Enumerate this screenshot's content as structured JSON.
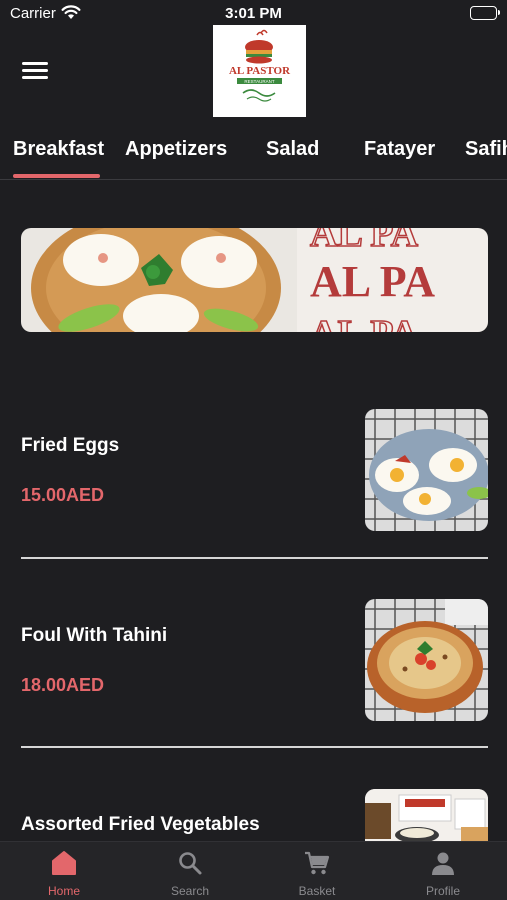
{
  "status_bar": {
    "carrier": "Carrier",
    "time": "3:01 PM"
  },
  "header": {
    "logo_text": "AL PASTOR",
    "logo_subtext": "RESTAURANT"
  },
  "tabs": [
    {
      "label": "Breakfast",
      "active": true
    },
    {
      "label": "Appetizers",
      "active": false
    },
    {
      "label": "Salad",
      "active": false
    },
    {
      "label": "Fatayer",
      "active": false
    },
    {
      "label": "Safih",
      "active": false
    }
  ],
  "banner": {
    "text_row": "AL PA"
  },
  "items": [
    {
      "name": "Fried Eggs",
      "price": "15.00AED"
    },
    {
      "name": "Foul With Tahini",
      "price": "18.00AED"
    },
    {
      "name": "Assorted Fried Vegetables",
      "price": ""
    }
  ],
  "bottom_nav": [
    {
      "label": "Home",
      "icon": "home-icon",
      "active": true
    },
    {
      "label": "Search",
      "icon": "search-icon",
      "active": false
    },
    {
      "label": "Basket",
      "icon": "cart-icon",
      "active": false
    },
    {
      "label": "Profile",
      "icon": "profile-icon",
      "active": false
    }
  ],
  "colors": {
    "background": "#1e1e21",
    "accent": "#e3676b",
    "text": "#ffffff",
    "nav_inactive": "#8a8a8e"
  }
}
